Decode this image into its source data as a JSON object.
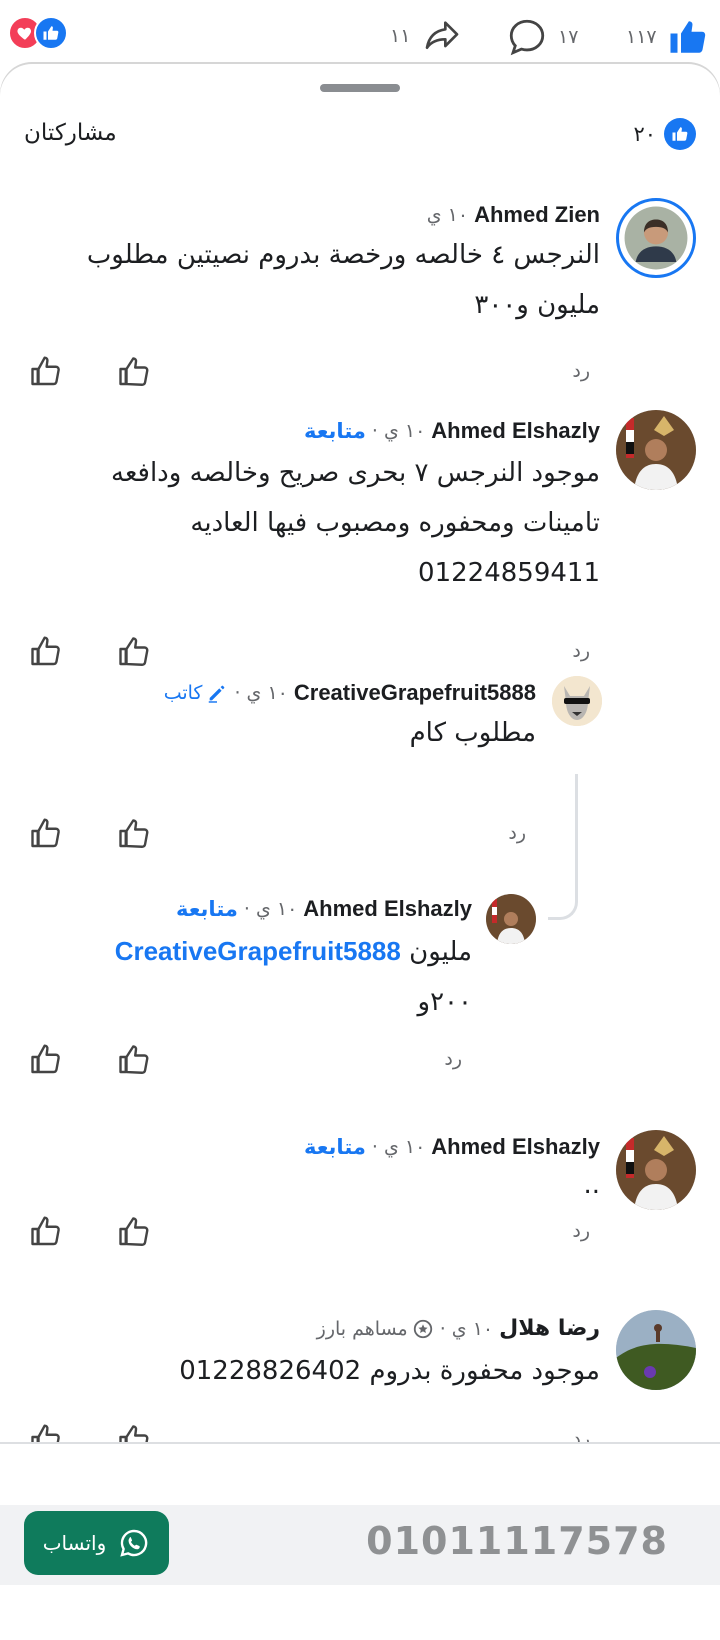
{
  "colors": {
    "accent": "#1877f2",
    "love": "#f33e58",
    "whatsapp": "#0f7b5c",
    "muted": "#65676b"
  },
  "top": {
    "shares": "١١",
    "comments": "١٧",
    "likes": "١١٧"
  },
  "header": {
    "title": "مشاركتان",
    "like_count": "٢٠"
  },
  "labels": {
    "reply": "رد",
    "follow": "متابعة"
  },
  "comments": [
    {
      "name": "Ahmed Zien",
      "time": "١٠ ي",
      "lines": [
        "النرجس ٤ خالصه ورخصة بدروم نصيتين مطلوب",
        "مليون و٣٠٠"
      ]
    },
    {
      "name": "Ahmed Elshazly",
      "time": "١٠ ي",
      "sep": "·",
      "follow": "متابعة",
      "lines": [
        "موجود النرجس ٧ بحرى صريح وخالصه ودافعه",
        "تامينات ومحفوره ومصبوب فيها العاديه",
        "01224859411"
      ]
    },
    {
      "name": "CreativeGrapefruit5888",
      "time": "١٠ ي",
      "author": "كاتب",
      "author_sep": "·",
      "lines": [
        "مطلوب كام"
      ]
    },
    {
      "name": "Ahmed Elshazly",
      "time": "١٠ ي",
      "sep": "·",
      "follow": "متابعة",
      "mention": "CreativeGrapefruit5888",
      "lines": [
        "مليون",
        "٢٠٠و"
      ]
    },
    {
      "name": "Ahmed Elshazly",
      "time": "١٠ ي",
      "sep": "·",
      "follow": "متابعة",
      "lines": [
        ".."
      ]
    },
    {
      "name": "رضا هلال",
      "time": "١٠ ي",
      "badge": "مساهم بارز",
      "badge_sep": "·",
      "lines": [
        "موجود محفورة بدروم 01228826402"
      ]
    }
  ],
  "banner": {
    "whatsapp_label": "واتساب",
    "phone": "01011117578"
  }
}
